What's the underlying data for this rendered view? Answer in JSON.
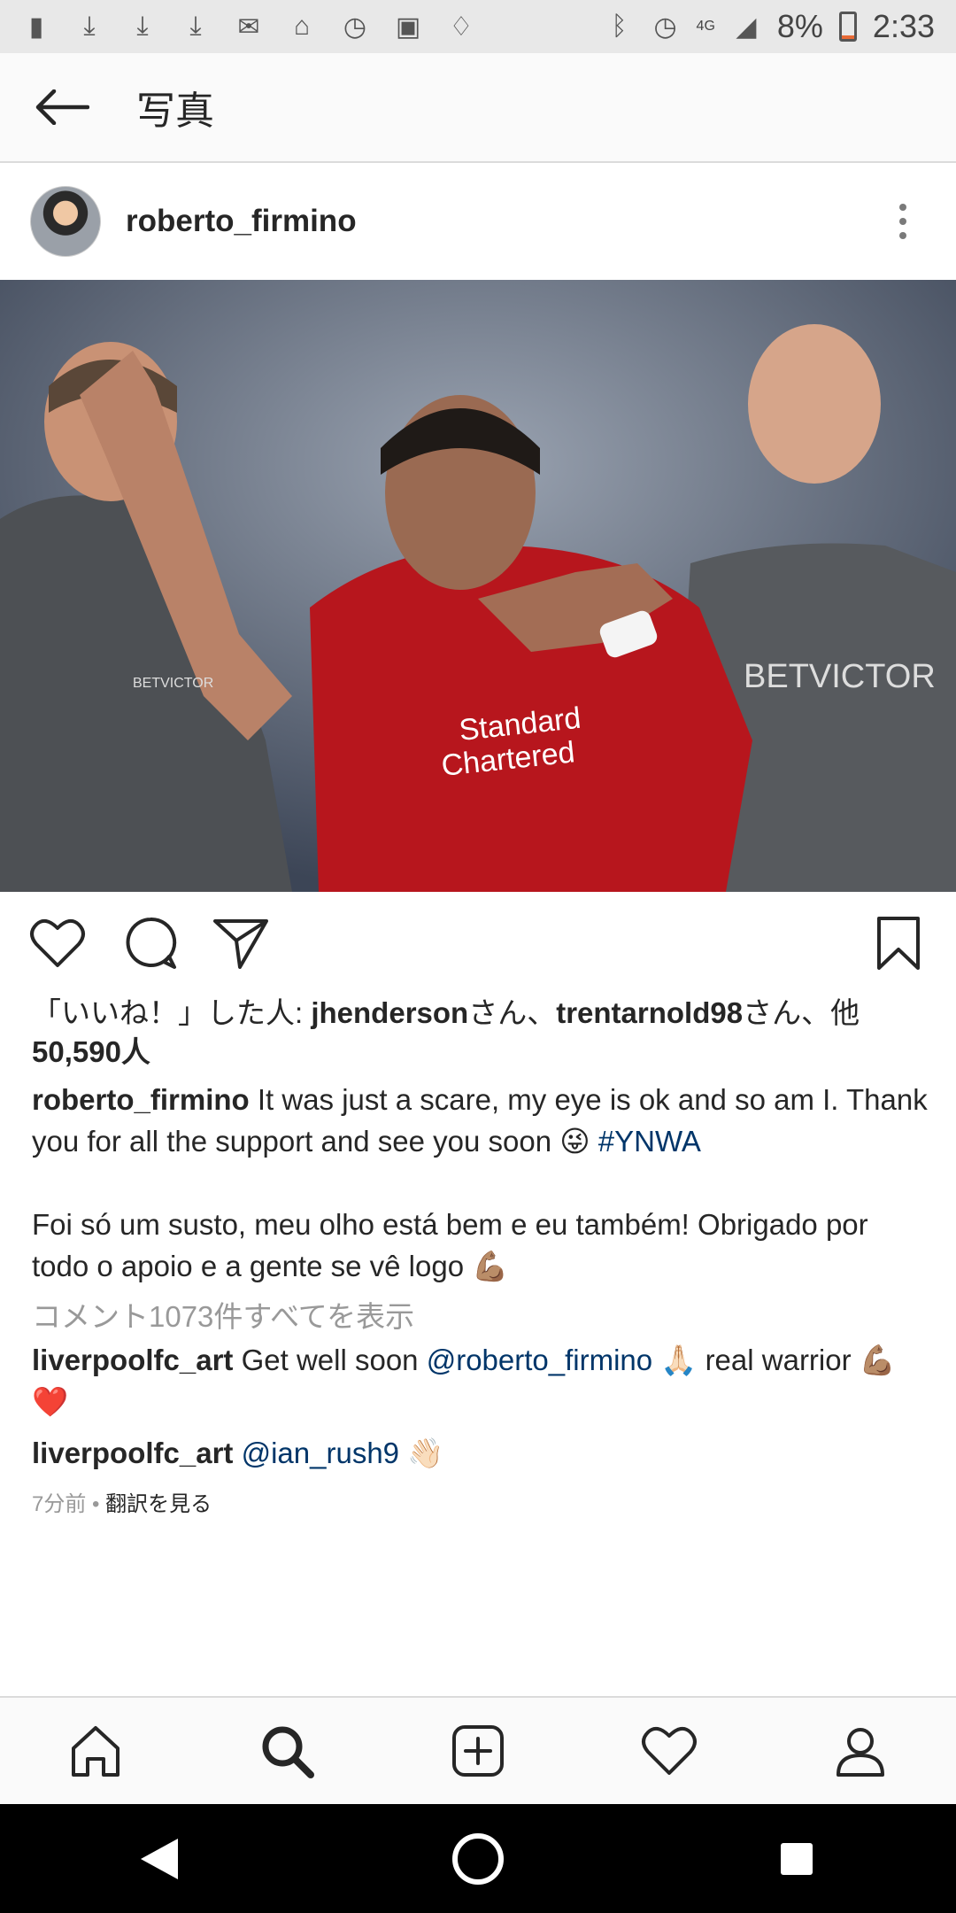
{
  "status_bar": {
    "battery": "8%",
    "time": "2:33",
    "network": "4G"
  },
  "app_bar": {
    "title": "写真"
  },
  "post": {
    "username": "roberto_firmino",
    "likes": {
      "prefix": "「いいね！」した人: ",
      "user1": "jhenderson",
      "mid1": "さん、",
      "user2": "trentarnold98",
      "mid2": "さん、他",
      "count": "50,590人"
    },
    "caption": {
      "author": "roberto_firmino",
      "text1": " It was just a scare, my eye is ok and so am I. Thank you for all the support and see you soon 😜 ",
      "hashtag": "#YNWA",
      "text2": "Foi só um susto, meu olho está bem e eu também! Obrigado por todo o apoio e a gente se vê logo 💪🏽"
    },
    "view_comments": "コメント1073件すべてを表示",
    "comments": [
      {
        "author": "liverpoolfc_art",
        "pre": " Get well soon ",
        "mention": "@roberto_firmino",
        "post": " 🙏🏻 real warrior 💪🏽❤️"
      },
      {
        "author": "liverpoolfc_art",
        "pre": " ",
        "mention": "@ian_rush9",
        "post": " 👋🏻"
      }
    ],
    "time_ago": "7分前",
    "separator": " • ",
    "translate": "翻訳を見る"
  }
}
